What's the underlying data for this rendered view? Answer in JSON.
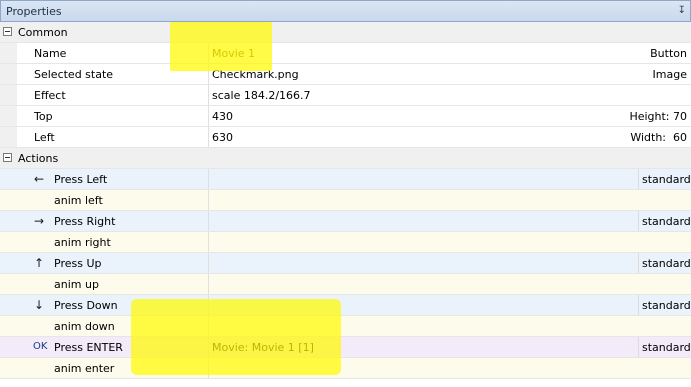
{
  "panel": {
    "title": "Properties",
    "pin_glyph": "↧"
  },
  "sections": {
    "common": "Common",
    "actions": "Actions"
  },
  "common": {
    "name_label": "Name",
    "name_value": "Movie 1",
    "name_extra": "Button",
    "state_label": "Selected state",
    "state_value": "Checkmark.png",
    "state_extra": "Image",
    "effect_label": "Effect",
    "effect_value": "scale 184.2/166.7",
    "top_label": "Top",
    "top_value": "430",
    "top_extra": "Height: 70",
    "left_label": "Left",
    "left_value": "630",
    "left_extra": "Width:  60"
  },
  "actions": {
    "press_left": "Press Left",
    "press_left_arrow": "←",
    "anim_left": "anim left",
    "press_right": "Press Right",
    "press_right_arrow": "→",
    "anim_right": "anim right",
    "press_up": "Press Up",
    "press_up_arrow": "↑",
    "anim_up": "anim up",
    "press_down": "Press Down",
    "press_down_arrow": "↓",
    "anim_down": "anim down",
    "press_enter": "Press ENTER",
    "press_enter_mark": "OK",
    "press_enter_value": "Movie: Movie 1 [1]",
    "anim_enter": "anim enter",
    "standard": "standard"
  }
}
